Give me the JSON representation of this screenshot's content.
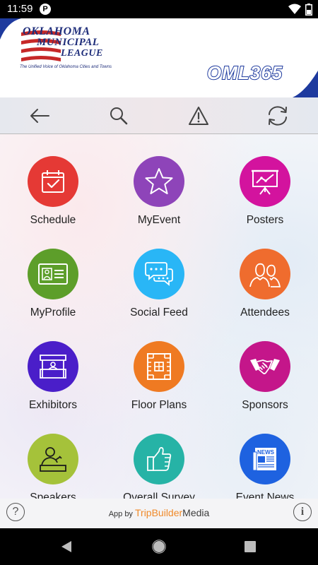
{
  "status_bar": {
    "time": "11:59",
    "notification_glyph": "P"
  },
  "banner": {
    "logo_line1": "OKLAHOMA",
    "logo_line2": "MUNICIPAL",
    "logo_line3": "LEAGUE",
    "logo_tagline": "The Unified Voice of Oklahoma Cities and Towns",
    "event_name": "OML365"
  },
  "toolbar": {
    "items": [
      {
        "name": "back",
        "icon": "arrow-left-icon"
      },
      {
        "name": "search",
        "icon": "search-icon"
      },
      {
        "name": "alerts",
        "icon": "warning-icon"
      },
      {
        "name": "sync",
        "icon": "refresh-icon"
      }
    ]
  },
  "menu": {
    "tiles": [
      {
        "label": "Schedule",
        "color": "#e53935",
        "icon": "calendar-check-icon"
      },
      {
        "label": "MyEvent",
        "color": "#8e44b9",
        "icon": "star-icon"
      },
      {
        "label": "Posters",
        "color": "#d3139e",
        "icon": "presentation-icon"
      },
      {
        "label": "MyProfile",
        "color": "#5d9e2a",
        "icon": "id-card-icon"
      },
      {
        "label": "Social Feed",
        "color": "#29b6f6",
        "icon": "chat-bubbles-icon"
      },
      {
        "label": "Attendees",
        "color": "#ef6c2e",
        "icon": "people-icon"
      },
      {
        "label": "Exhibitors",
        "color": "#4a1ec9",
        "icon": "booth-icon"
      },
      {
        "label": "Floor Plans",
        "color": "#ef7a22",
        "icon": "floor-plan-icon"
      },
      {
        "label": "Sponsors",
        "color": "#c4168a",
        "icon": "handshake-icon"
      },
      {
        "label": "Speakers",
        "color": "#a5c23a",
        "icon": "speaker-podium-icon"
      },
      {
        "label": "Overall Survey",
        "color": "#26b3a6",
        "icon": "thumbs-up-icon"
      },
      {
        "label": "Event News",
        "color": "#1e62e0",
        "icon": "newspaper-icon"
      }
    ]
  },
  "footer": {
    "help_glyph": "?",
    "info_glyph": "i",
    "app_by": "App by",
    "brand_trip": "TripBuilder",
    "brand_media": "Media"
  },
  "colors": {
    "navy": "#1e2d7a",
    "accent_orange": "#f08a2a"
  }
}
